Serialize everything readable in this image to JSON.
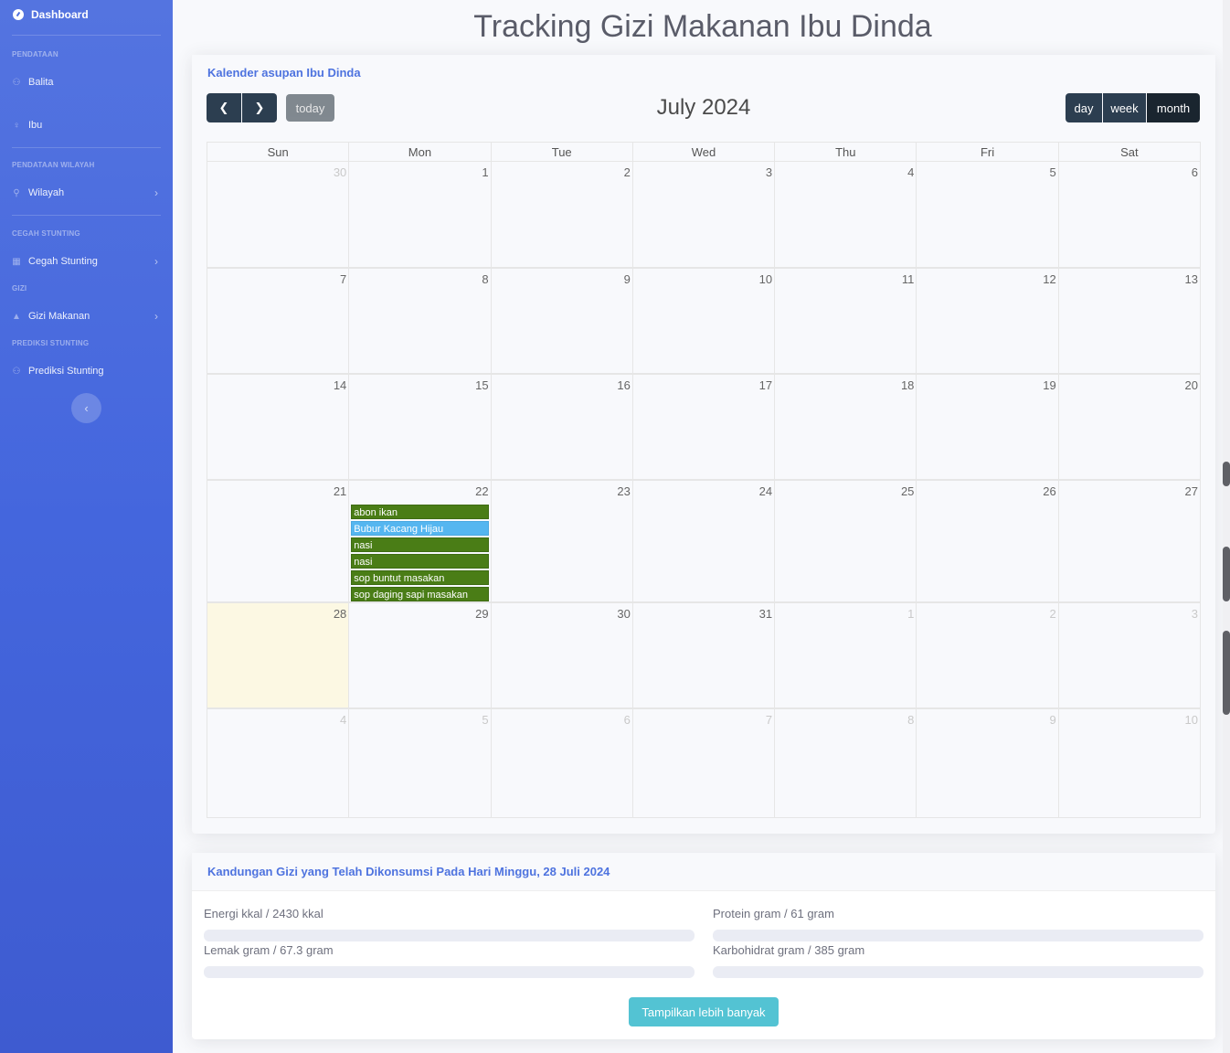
{
  "sidebar": {
    "brand": "Dashboard",
    "sections": [
      {
        "heading": "PENDATAAN"
      },
      {
        "heading": "PENDATAAN WILAYAH"
      },
      {
        "heading": "CEGAH STUNTING"
      },
      {
        "heading": "GIZI"
      },
      {
        "heading": "PREDIKSI STUNTING"
      }
    ],
    "items": [
      {
        "label": "Balita",
        "icon": "child-icon"
      },
      {
        "label": "Ibu",
        "icon": "female-icon"
      },
      {
        "label": "Wilayah",
        "icon": "map-marker-icon"
      },
      {
        "label": "Cegah Stunting",
        "icon": "table-icon"
      },
      {
        "label": "Gizi Makanan",
        "icon": "bowl-icon"
      },
      {
        "label": "Prediksi Stunting",
        "icon": "child-icon"
      }
    ],
    "toggle_icon": "chevron-left-icon"
  },
  "page": {
    "title": "Tracking Gizi Makanan Ibu Dinda"
  },
  "calendar": {
    "card_title": "Kalender asupan Ibu Dinda",
    "today_label": "today",
    "month_title": "July 2024",
    "views": [
      "day",
      "week",
      "month"
    ],
    "active_view": "month",
    "weekdays": [
      "Sun",
      "Mon",
      "Tue",
      "Wed",
      "Thu",
      "Fri",
      "Sat"
    ],
    "weeks": [
      [
        "30",
        "1",
        "2",
        "3",
        "4",
        "5",
        "6"
      ],
      [
        "7",
        "8",
        "9",
        "10",
        "11",
        "12",
        "13"
      ],
      [
        "14",
        "15",
        "16",
        "17",
        "18",
        "19",
        "20"
      ],
      [
        "21",
        "22",
        "23",
        "24",
        "25",
        "26",
        "27"
      ],
      [
        "28",
        "29",
        "30",
        "31",
        "1",
        "2",
        "3"
      ],
      [
        "4",
        "5",
        "6",
        "7",
        "8",
        "9",
        "10"
      ]
    ],
    "events_22": [
      {
        "title": "abon ikan",
        "color": "#4a7d16"
      },
      {
        "title": "Bubur Kacang Hijau",
        "color": "#55b6f0"
      },
      {
        "title": "nasi",
        "color": "#4a7d16"
      },
      {
        "title": "nasi",
        "color": "#4a7d16"
      },
      {
        "title": "sop buntut masakan",
        "color": "#4a7d16"
      },
      {
        "title": "sop daging sapi masakan",
        "color": "#4a7d16"
      }
    ]
  },
  "nutrition": {
    "card_title": "Kandungan Gizi yang Telah Dikonsumsi Pada Hari Minggu, 28 Juli 2024",
    "items": [
      {
        "label": "Energi kkal / 2430 kkal",
        "progress": 0
      },
      {
        "label": "Protein gram / 61 gram",
        "progress": 0
      },
      {
        "label": "Lemak gram / 67.3 gram",
        "progress": 0
      },
      {
        "label": "Karbohidrat gram / 385 gram",
        "progress": 0
      }
    ],
    "more_button": "Tampilkan lebih banyak"
  }
}
